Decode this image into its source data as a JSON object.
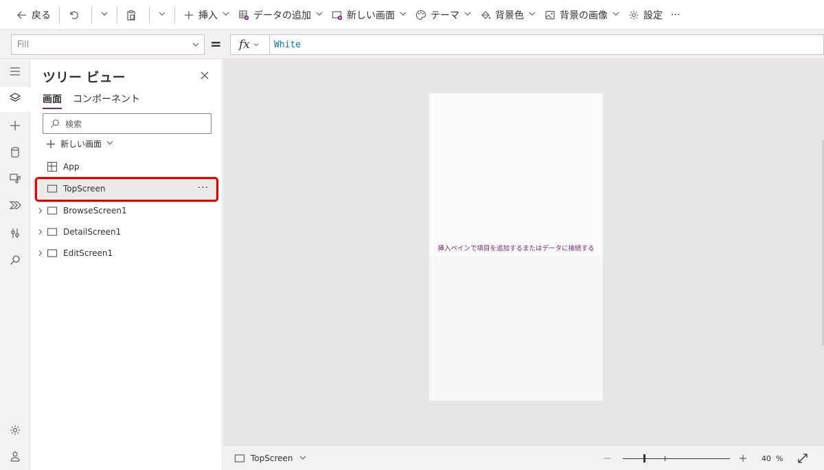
{
  "toolbar": {
    "back": "戻る",
    "insert": "挿入",
    "add_data": "データの追加",
    "new_screen": "新しい画面",
    "theme": "テーマ",
    "background_color": "背景色",
    "background_image": "背景の画像",
    "settings": "設定",
    "more": "···"
  },
  "formula_bar": {
    "property": "Fill",
    "equals": "=",
    "fx": "fx",
    "formula": "White"
  },
  "tree_view": {
    "title": "ツリー ビュー",
    "tabs": [
      {
        "label": "画面",
        "active": true
      },
      {
        "label": "コンポーネント",
        "active": false
      }
    ],
    "search_placeholder": "検索",
    "new_screen": "新しい画面",
    "items": [
      {
        "label": "App",
        "icon": "app-grid-icon",
        "expandable": false,
        "selected": false
      },
      {
        "label": "TopScreen",
        "icon": "screen-icon",
        "expandable": false,
        "selected": true,
        "more": "···"
      },
      {
        "label": "BrowseScreen1",
        "icon": "screen-icon",
        "expandable": true,
        "selected": false
      },
      {
        "label": "DetailScreen1",
        "icon": "screen-icon",
        "expandable": true,
        "selected": false
      },
      {
        "label": "EditScreen1",
        "icon": "screen-icon",
        "expandable": true,
        "selected": false
      }
    ]
  },
  "canvas": {
    "hint": "挿入ペインで項目を追加するまたはデータに接続する"
  },
  "statusbar": {
    "screen": "TopScreen",
    "zoom_value": "40",
    "zoom_unit": "%"
  },
  "colors": {
    "accent": "#742774",
    "highlight_border": "#e60000",
    "formula_text": "#0078b4"
  }
}
